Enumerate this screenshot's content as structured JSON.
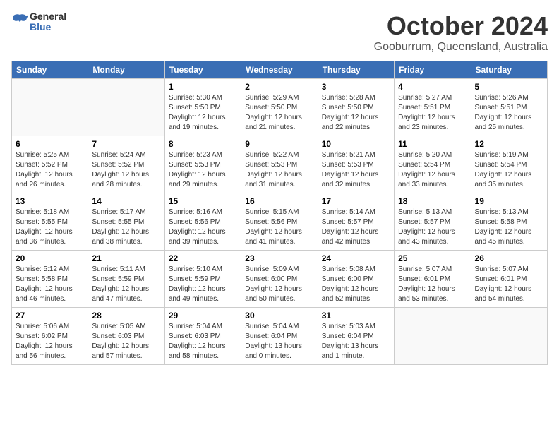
{
  "header": {
    "logo_general": "General",
    "logo_blue": "Blue",
    "month": "October 2024",
    "location": "Gooburrum, Queensland, Australia"
  },
  "weekdays": [
    "Sunday",
    "Monday",
    "Tuesday",
    "Wednesday",
    "Thursday",
    "Friday",
    "Saturday"
  ],
  "weeks": [
    [
      {
        "day": "",
        "detail": ""
      },
      {
        "day": "",
        "detail": ""
      },
      {
        "day": "1",
        "detail": "Sunrise: 5:30 AM\nSunset: 5:50 PM\nDaylight: 12 hours and 19 minutes."
      },
      {
        "day": "2",
        "detail": "Sunrise: 5:29 AM\nSunset: 5:50 PM\nDaylight: 12 hours and 21 minutes."
      },
      {
        "day": "3",
        "detail": "Sunrise: 5:28 AM\nSunset: 5:50 PM\nDaylight: 12 hours and 22 minutes."
      },
      {
        "day": "4",
        "detail": "Sunrise: 5:27 AM\nSunset: 5:51 PM\nDaylight: 12 hours and 23 minutes."
      },
      {
        "day": "5",
        "detail": "Sunrise: 5:26 AM\nSunset: 5:51 PM\nDaylight: 12 hours and 25 minutes."
      }
    ],
    [
      {
        "day": "6",
        "detail": "Sunrise: 5:25 AM\nSunset: 5:52 PM\nDaylight: 12 hours and 26 minutes."
      },
      {
        "day": "7",
        "detail": "Sunrise: 5:24 AM\nSunset: 5:52 PM\nDaylight: 12 hours and 28 minutes."
      },
      {
        "day": "8",
        "detail": "Sunrise: 5:23 AM\nSunset: 5:53 PM\nDaylight: 12 hours and 29 minutes."
      },
      {
        "day": "9",
        "detail": "Sunrise: 5:22 AM\nSunset: 5:53 PM\nDaylight: 12 hours and 31 minutes."
      },
      {
        "day": "10",
        "detail": "Sunrise: 5:21 AM\nSunset: 5:53 PM\nDaylight: 12 hours and 32 minutes."
      },
      {
        "day": "11",
        "detail": "Sunrise: 5:20 AM\nSunset: 5:54 PM\nDaylight: 12 hours and 33 minutes."
      },
      {
        "day": "12",
        "detail": "Sunrise: 5:19 AM\nSunset: 5:54 PM\nDaylight: 12 hours and 35 minutes."
      }
    ],
    [
      {
        "day": "13",
        "detail": "Sunrise: 5:18 AM\nSunset: 5:55 PM\nDaylight: 12 hours and 36 minutes."
      },
      {
        "day": "14",
        "detail": "Sunrise: 5:17 AM\nSunset: 5:55 PM\nDaylight: 12 hours and 38 minutes."
      },
      {
        "day": "15",
        "detail": "Sunrise: 5:16 AM\nSunset: 5:56 PM\nDaylight: 12 hours and 39 minutes."
      },
      {
        "day": "16",
        "detail": "Sunrise: 5:15 AM\nSunset: 5:56 PM\nDaylight: 12 hours and 41 minutes."
      },
      {
        "day": "17",
        "detail": "Sunrise: 5:14 AM\nSunset: 5:57 PM\nDaylight: 12 hours and 42 minutes."
      },
      {
        "day": "18",
        "detail": "Sunrise: 5:13 AM\nSunset: 5:57 PM\nDaylight: 12 hours and 43 minutes."
      },
      {
        "day": "19",
        "detail": "Sunrise: 5:13 AM\nSunset: 5:58 PM\nDaylight: 12 hours and 45 minutes."
      }
    ],
    [
      {
        "day": "20",
        "detail": "Sunrise: 5:12 AM\nSunset: 5:58 PM\nDaylight: 12 hours and 46 minutes."
      },
      {
        "day": "21",
        "detail": "Sunrise: 5:11 AM\nSunset: 5:59 PM\nDaylight: 12 hours and 47 minutes."
      },
      {
        "day": "22",
        "detail": "Sunrise: 5:10 AM\nSunset: 5:59 PM\nDaylight: 12 hours and 49 minutes."
      },
      {
        "day": "23",
        "detail": "Sunrise: 5:09 AM\nSunset: 6:00 PM\nDaylight: 12 hours and 50 minutes."
      },
      {
        "day": "24",
        "detail": "Sunrise: 5:08 AM\nSunset: 6:00 PM\nDaylight: 12 hours and 52 minutes."
      },
      {
        "day": "25",
        "detail": "Sunrise: 5:07 AM\nSunset: 6:01 PM\nDaylight: 12 hours and 53 minutes."
      },
      {
        "day": "26",
        "detail": "Sunrise: 5:07 AM\nSunset: 6:01 PM\nDaylight: 12 hours and 54 minutes."
      }
    ],
    [
      {
        "day": "27",
        "detail": "Sunrise: 5:06 AM\nSunset: 6:02 PM\nDaylight: 12 hours and 56 minutes."
      },
      {
        "day": "28",
        "detail": "Sunrise: 5:05 AM\nSunset: 6:03 PM\nDaylight: 12 hours and 57 minutes."
      },
      {
        "day": "29",
        "detail": "Sunrise: 5:04 AM\nSunset: 6:03 PM\nDaylight: 12 hours and 58 minutes."
      },
      {
        "day": "30",
        "detail": "Sunrise: 5:04 AM\nSunset: 6:04 PM\nDaylight: 13 hours and 0 minutes."
      },
      {
        "day": "31",
        "detail": "Sunrise: 5:03 AM\nSunset: 6:04 PM\nDaylight: 13 hours and 1 minute."
      },
      {
        "day": "",
        "detail": ""
      },
      {
        "day": "",
        "detail": ""
      }
    ]
  ]
}
